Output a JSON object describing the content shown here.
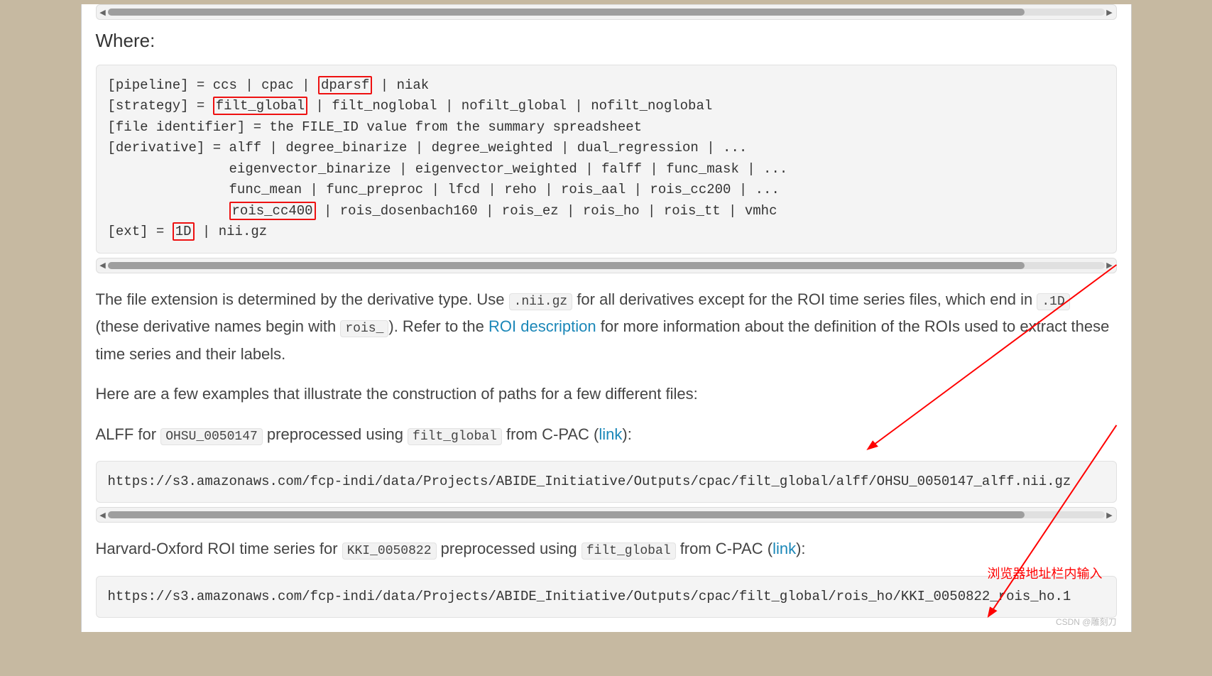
{
  "where_heading": "Where:",
  "code1_l1a": "[pipeline] = ccs | cpac | ",
  "code1_l1_box": "dparsf",
  "code1_l1b": " | niak",
  "code1_l2a": "[strategy] = ",
  "code1_l2_box": "filt_global",
  "code1_l2b": " | filt_noglobal | nofilt_global | nofilt_noglobal",
  "code1_l3": "[file identifier] = the FILE_ID value from the summary spreadsheet",
  "code1_l4": "[derivative] = alff | degree_binarize | degree_weighted | dual_regression | ...",
  "code1_l5": "               eigenvector_binarize | eigenvector_weighted | falff | func_mask | ...",
  "code1_l6": "               func_mean | func_preproc | lfcd | reho | rois_aal | rois_cc200 | ...",
  "code1_l7a": "               ",
  "code1_l7_box": "rois_cc400",
  "code1_l7b": " | rois_dosenbach160 | rois_ez | rois_ho | rois_tt | vmhc",
  "code1_l8a": "[ext] = ",
  "code1_l8_box": "1D",
  "code1_l8b": " | nii.gz",
  "p1_a": "The file extension is determined by the derivative type. Use ",
  "p1_code1": ".nii.gz",
  "p1_b": " for all derivatives except for the ROI time series files, which end in ",
  "p1_code2": ".1D",
  "p1_c": " (these derivative names begin with ",
  "p1_code3": "rois_",
  "p1_d": "). Refer to the ",
  "p1_link": "ROI description",
  "p1_e": " for more information about the definition of the ROIs used to extract these time series and their labels.",
  "p2": "Here are a few examples that illustrate the construction of paths for a few different files:",
  "p3_a": "ALFF for ",
  "p3_code1": "OHSU_0050147",
  "p3_b": " preprocessed using ",
  "p3_code2": "filt_global",
  "p3_c": " from C-PAC (",
  "p3_link": "link",
  "p3_d": "):",
  "code2": "https://s3.amazonaws.com/fcp-indi/data/Projects/ABIDE_Initiative/Outputs/cpac/filt_global/alff/OHSU_0050147_alff.nii.gz",
  "p4_a": "Harvard-Oxford ROI time series for ",
  "p4_code1": "KKI_0050822",
  "p4_b": " preprocessed using ",
  "p4_code2": "filt_global",
  "p4_c": " from C-PAC (",
  "p4_link": "link",
  "p4_d": "):",
  "code3": "https://s3.amazonaws.com/fcp-indi/data/Projects/ABIDE_Initiative/Outputs/cpac/filt_global/rois_ho/KKI_0050822_rois_ho.1",
  "annot_input": "浏览器地址栏内输入",
  "watermark": "CSDN @雕刻刀"
}
